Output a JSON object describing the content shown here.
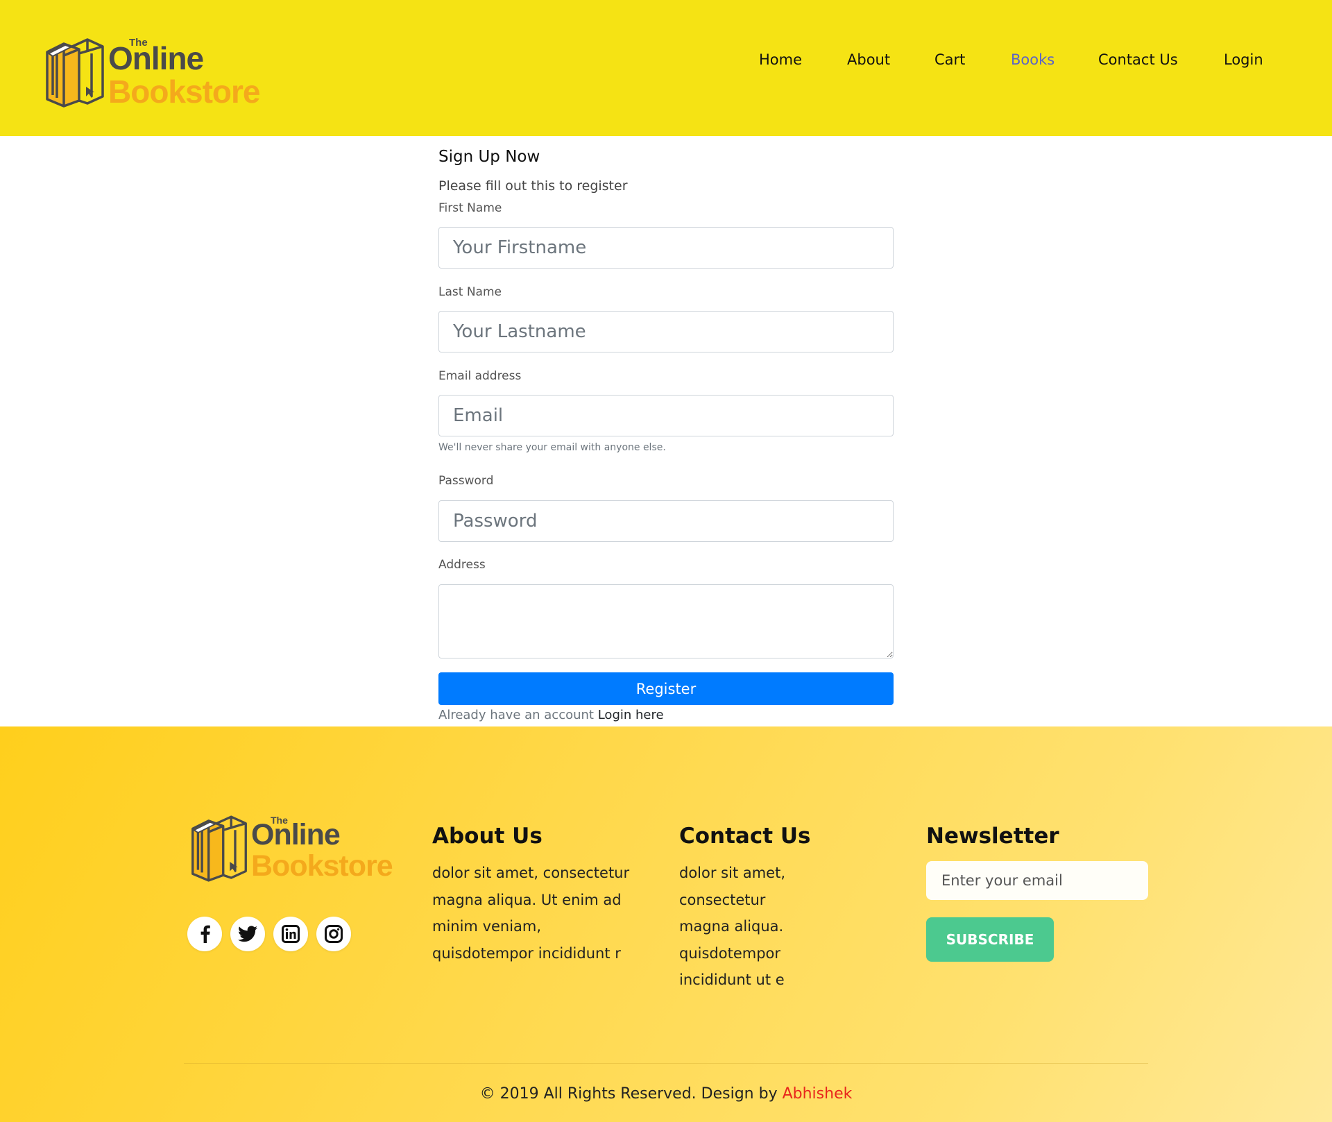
{
  "brand": {
    "the": "The",
    "online": "Online",
    "bookstore": "Bookstore"
  },
  "nav": {
    "items": [
      {
        "label": "Home",
        "active": false
      },
      {
        "label": "About",
        "active": false
      },
      {
        "label": "Cart",
        "active": false
      },
      {
        "label": "Books",
        "active": true
      },
      {
        "label": "Contact Us",
        "active": false
      },
      {
        "label": "Login",
        "active": false
      }
    ]
  },
  "form": {
    "title": "Sign Up Now",
    "subtitle": "Please fill out this to register",
    "first_name": {
      "label": "First Name",
      "placeholder": "Your Firstname",
      "value": ""
    },
    "last_name": {
      "label": "Last Name",
      "placeholder": "Your Lastname",
      "value": ""
    },
    "email": {
      "label": "Email address",
      "placeholder": "Email",
      "value": "",
      "help": "We'll never share your email with anyone else."
    },
    "password": {
      "label": "Password",
      "placeholder": "Password",
      "value": ""
    },
    "address": {
      "label": "Address",
      "value": ""
    },
    "register_label": "Register",
    "have_account_text": "Already have an account",
    "login_link": "Login here"
  },
  "footer": {
    "social": [
      {
        "icon": "facebook-icon"
      },
      {
        "icon": "twitter-icon"
      },
      {
        "icon": "linkedin-icon"
      },
      {
        "icon": "instagram-icon"
      }
    ],
    "about": {
      "heading": "About Us",
      "lines": [
        "dolor sit amet, consectetur",
        "magna aliqua. Ut enim ad",
        "minim veniam,",
        "quisdotempor incididunt r"
      ]
    },
    "contact": {
      "heading": "Contact Us",
      "lines": [
        "dolor sit amet,",
        "consectetur",
        "magna aliqua.",
        "quisdotempor",
        "incididunt ut e"
      ]
    },
    "newsletter": {
      "heading": "Newsletter",
      "placeholder": "Enter your email",
      "subscribe_label": "SUBSCRIBE"
    },
    "copyright_text": "© 2019 All Rights Reserved. Design by",
    "author": "Abhishek"
  },
  "colors": {
    "header_bg": "#f5e314",
    "nav_active": "#5a63c8",
    "register_button": "#007bff",
    "subscribe_button": "#4cc98f",
    "author_link": "#e8261c",
    "brand_orange": "#f4a91c"
  }
}
